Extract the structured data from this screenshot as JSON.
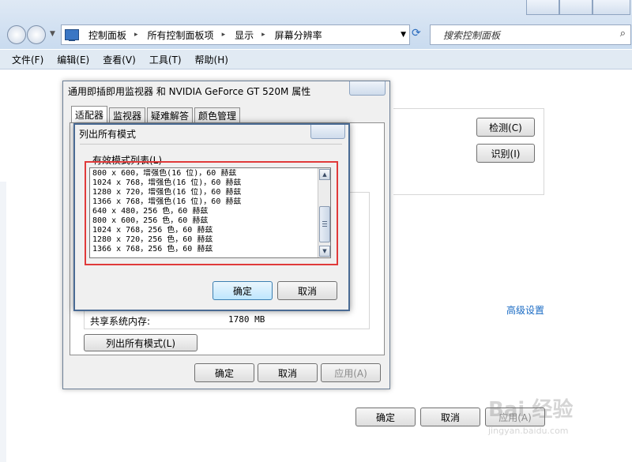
{
  "window": {
    "address_crumbs": [
      "控制面板",
      "所有控制面板项",
      "显示",
      "屏幕分辨率"
    ],
    "search_placeholder": "搜索控制面板",
    "menu": [
      "文件(F)",
      "编辑(E)",
      "查看(V)",
      "工具(T)",
      "帮助(H)"
    ]
  },
  "main_page": {
    "detect_label": "检测(C)",
    "identify_label": "识别(I)",
    "advanced_link": "高级设置",
    "ok_label": "确定",
    "cancel_label": "取消",
    "apply_label": "应用(A)"
  },
  "properties_dialog": {
    "title": "通用即插即用监视器 和 NVIDIA GeForce GT 520M 属性",
    "tabs": [
      "适配器",
      "监视器",
      "疑难解答",
      "颜色管理"
    ],
    "shared_memory_label": "共享系统内存:",
    "shared_memory_value": "1780 MB",
    "list_all_modes_label": "列出所有模式(L)",
    "ok_label": "确定",
    "cancel_label": "取消",
    "apply_label": "应用(A)"
  },
  "modes_dialog": {
    "title": "列出所有模式",
    "list_label": "有效模式列表(L)",
    "modes": [
      "800 x 600，增强色(16 位)，60 赫兹",
      "1024 x 768，增强色(16 位)，60 赫兹",
      "1280 x 720，增强色(16 位)，60 赫兹",
      "1366 x 768，增强色(16 位)，60 赫兹",
      "640 x 480，256 色，60 赫兹",
      "800 x 600，256 色，60 赫兹",
      "1024 x 768，256 色，60 赫兹",
      "1280 x 720，256 色，60 赫兹",
      "1366 x 768，256 色，60 赫兹"
    ],
    "ok_label": "确定",
    "cancel_label": "取消"
  },
  "watermark": {
    "brand": "Bai 经验",
    "url": "jingyan.baidu.com"
  },
  "colors": {
    "highlight": "#e03a3a",
    "link": "#1a6bc4",
    "chrome": "#dfe9f5"
  }
}
